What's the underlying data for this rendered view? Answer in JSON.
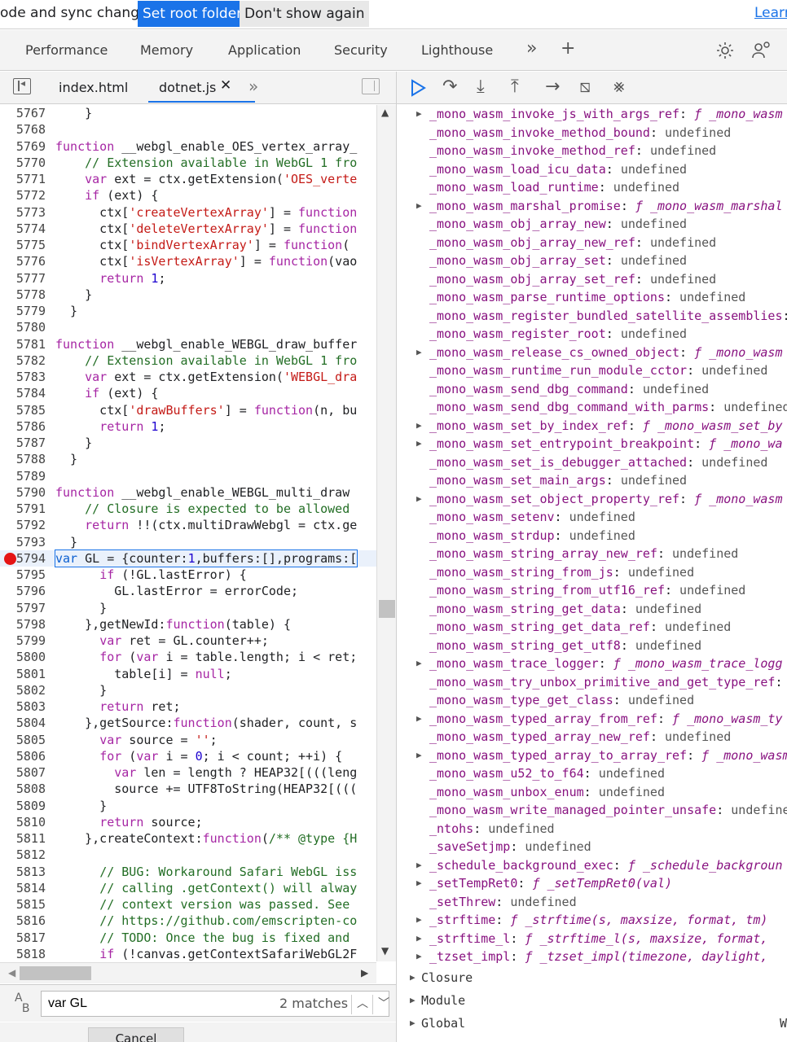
{
  "infobar": {
    "message": "ode and sync changes.",
    "set_root": "Set root folder",
    "dont_show": "Don't show again",
    "learn": "Learn"
  },
  "panel_tabs": [
    "Performance",
    "Memory",
    "Application",
    "Security",
    "Lighthouse"
  ],
  "file_tabs": [
    "index.html",
    "dotnet.js"
  ],
  "code_lines": [
    {
      "n": "5767",
      "html": "    }"
    },
    {
      "n": "5768",
      "html": ""
    },
    {
      "n": "5769",
      "html": "<span class=\"kw\">function</span> __webgl_enable_OES_vertex_array_"
    },
    {
      "n": "5770",
      "html": "    <span class=\"cm\">// Extension available in WebGL 1 fro</span>"
    },
    {
      "n": "5771",
      "html": "    <span class=\"kw\">var</span> ext = ctx.getExtension(<span class=\"str\">'OES_verte</span>"
    },
    {
      "n": "5772",
      "html": "    <span class=\"kw\">if</span> (ext) {"
    },
    {
      "n": "5773",
      "html": "      ctx[<span class=\"str\">'createVertexArray'</span>] = <span class=\"kw\">function</span>"
    },
    {
      "n": "5774",
      "html": "      ctx[<span class=\"str\">'deleteVertexArray'</span>] = <span class=\"kw\">function</span>"
    },
    {
      "n": "5775",
      "html": "      ctx[<span class=\"str\">'bindVertexArray'</span>] = <span class=\"kw\">function</span>("
    },
    {
      "n": "5776",
      "html": "      ctx[<span class=\"str\">'isVertexArray'</span>] = <span class=\"kw\">function</span>(vao"
    },
    {
      "n": "5777",
      "html": "      <span class=\"kw\">return</span> <span class=\"num\">1</span>;"
    },
    {
      "n": "5778",
      "html": "    }"
    },
    {
      "n": "5779",
      "html": "  }"
    },
    {
      "n": "5780",
      "html": ""
    },
    {
      "n": "5781",
      "html": "<span class=\"kw\">function</span> __webgl_enable_WEBGL_draw_buffer"
    },
    {
      "n": "5782",
      "html": "    <span class=\"cm\">// Extension available in WebGL 1 fro</span>"
    },
    {
      "n": "5783",
      "html": "    <span class=\"kw\">var</span> ext = ctx.getExtension(<span class=\"str\">'WEBGL_dra</span>"
    },
    {
      "n": "5784",
      "html": "    <span class=\"kw\">if</span> (ext) {"
    },
    {
      "n": "5785",
      "html": "      ctx[<span class=\"str\">'drawBuffers'</span>] = <span class=\"kw\">function</span>(n, bu"
    },
    {
      "n": "5786",
      "html": "      <span class=\"kw\">return</span> <span class=\"num\">1</span>;"
    },
    {
      "n": "5787",
      "html": "    }"
    },
    {
      "n": "5788",
      "html": "  }"
    },
    {
      "n": "5789",
      "html": ""
    },
    {
      "n": "5790",
      "html": "<span class=\"kw\">function</span> __webgl_enable_WEBGL_multi_draw"
    },
    {
      "n": "5791",
      "html": "    <span class=\"cm\">// Closure is expected to be allowed</span>"
    },
    {
      "n": "5792",
      "html": "    <span class=\"kw\">return</span> !!(ctx.multiDrawWebgl = ctx.ge"
    },
    {
      "n": "5793",
      "html": "  }"
    },
    {
      "n": "5794",
      "html": "<span class=\"kw2\">var</span> GL = {counter:<span class=\"num\">1</span>,buffers:[],programs:[",
      "bp": true
    },
    {
      "n": "5795",
      "html": "      <span class=\"kw\">if</span> (!GL.lastError) {"
    },
    {
      "n": "5796",
      "html": "        GL.lastError = errorCode;"
    },
    {
      "n": "5797",
      "html": "      }"
    },
    {
      "n": "5798",
      "html": "    },getNewId:<span class=\"kw\">function</span>(table) {"
    },
    {
      "n": "5799",
      "html": "      <span class=\"kw\">var</span> ret = GL.counter++;"
    },
    {
      "n": "5800",
      "html": "      <span class=\"kw\">for</span> (<span class=\"kw\">var</span> i = table.length; i &lt; ret;"
    },
    {
      "n": "5801",
      "html": "        table[i] = <span class=\"kw\">null</span>;"
    },
    {
      "n": "5802",
      "html": "      }"
    },
    {
      "n": "5803",
      "html": "      <span class=\"kw\">return</span> ret;"
    },
    {
      "n": "5804",
      "html": "    },getSource:<span class=\"kw\">function</span>(shader, count, s"
    },
    {
      "n": "5805",
      "html": "      <span class=\"kw\">var</span> source = <span class=\"str\">''</span>;"
    },
    {
      "n": "5806",
      "html": "      <span class=\"kw\">for</span> (<span class=\"kw\">var</span> i = <span class=\"num\">0</span>; i &lt; count; ++i) {"
    },
    {
      "n": "5807",
      "html": "        <span class=\"kw\">var</span> len = length ? HEAP32[(((leng"
    },
    {
      "n": "5808",
      "html": "        source += UTF8ToString(HEAP32[((("
    },
    {
      "n": "5809",
      "html": "      }"
    },
    {
      "n": "5810",
      "html": "      <span class=\"kw\">return</span> source;"
    },
    {
      "n": "5811",
      "html": "    },createContext:<span class=\"kw\">function</span>(<span class=\"cm\">/** @type {H</span>"
    },
    {
      "n": "5812",
      "html": ""
    },
    {
      "n": "5813",
      "html": "      <span class=\"cm\">// BUG: Workaround Safari WebGL iss</span>"
    },
    {
      "n": "5814",
      "html": "      <span class=\"cm\">// calling .getContext() will alway</span>"
    },
    {
      "n": "5815",
      "html": "      <span class=\"cm\">// context version was passed. See</span>"
    },
    {
      "n": "5816",
      "html": "      <span class=\"cm\">// https://github.com/emscripten-co</span>"
    },
    {
      "n": "5817",
      "html": "      <span class=\"cm\">// TODO: Once the bug is fixed and</span>"
    },
    {
      "n": "5818",
      "html": "      <span class=\"kw\">if</span> (!canvas.getContextSafariWebGL2F"
    }
  ],
  "scope_rows": [
    {
      "a": true,
      "k": "_mono_wasm_invoke_js_with_args_ref",
      "f": "_mono_wasm"
    },
    {
      "a": false,
      "k": "_mono_wasm_invoke_method_bound",
      "v": "undefined"
    },
    {
      "a": false,
      "k": "_mono_wasm_invoke_method_ref",
      "v": "undefined"
    },
    {
      "a": false,
      "k": "_mono_wasm_load_icu_data",
      "v": "undefined"
    },
    {
      "a": false,
      "k": "_mono_wasm_load_runtime",
      "v": "undefined"
    },
    {
      "a": true,
      "k": "_mono_wasm_marshal_promise",
      "f": "_mono_wasm_marshal"
    },
    {
      "a": false,
      "k": "_mono_wasm_obj_array_new",
      "v": "undefined"
    },
    {
      "a": false,
      "k": "_mono_wasm_obj_array_new_ref",
      "v": "undefined"
    },
    {
      "a": false,
      "k": "_mono_wasm_obj_array_set",
      "v": "undefined"
    },
    {
      "a": false,
      "k": "_mono_wasm_obj_array_set_ref",
      "v": "undefined"
    },
    {
      "a": false,
      "k": "_mono_wasm_parse_runtime_options",
      "v": "undefined"
    },
    {
      "a": false,
      "k": "_mono_wasm_register_bundled_satellite_assemblies",
      "v": ""
    },
    {
      "a": false,
      "k": "_mono_wasm_register_root",
      "v": "undefined"
    },
    {
      "a": true,
      "k": "_mono_wasm_release_cs_owned_object",
      "f": "_mono_wasm"
    },
    {
      "a": false,
      "k": "_mono_wasm_runtime_run_module_cctor",
      "v": "undefined"
    },
    {
      "a": false,
      "k": "_mono_wasm_send_dbg_command",
      "v": "undefined"
    },
    {
      "a": false,
      "k": "_mono_wasm_send_dbg_command_with_parms",
      "v": "undefined"
    },
    {
      "a": true,
      "k": "_mono_wasm_set_by_index_ref",
      "f": "_mono_wasm_set_by"
    },
    {
      "a": true,
      "k": "_mono_wasm_set_entrypoint_breakpoint",
      "f": "_mono_wa"
    },
    {
      "a": false,
      "k": "_mono_wasm_set_is_debugger_attached",
      "v": "undefined"
    },
    {
      "a": false,
      "k": "_mono_wasm_set_main_args",
      "v": "undefined"
    },
    {
      "a": true,
      "k": "_mono_wasm_set_object_property_ref",
      "f": "_mono_wasm"
    },
    {
      "a": false,
      "k": "_mono_wasm_setenv",
      "v": "undefined"
    },
    {
      "a": false,
      "k": "_mono_wasm_strdup",
      "v": "undefined"
    },
    {
      "a": false,
      "k": "_mono_wasm_string_array_new_ref",
      "v": "undefined"
    },
    {
      "a": false,
      "k": "_mono_wasm_string_from_js",
      "v": "undefined"
    },
    {
      "a": false,
      "k": "_mono_wasm_string_from_utf16_ref",
      "v": "undefined"
    },
    {
      "a": false,
      "k": "_mono_wasm_string_get_data",
      "v": "undefined"
    },
    {
      "a": false,
      "k": "_mono_wasm_string_get_data_ref",
      "v": "undefined"
    },
    {
      "a": false,
      "k": "_mono_wasm_string_get_utf8",
      "v": "undefined"
    },
    {
      "a": true,
      "k": "_mono_wasm_trace_logger",
      "f": "_mono_wasm_trace_logg"
    },
    {
      "a": false,
      "k": "_mono_wasm_try_unbox_primitive_and_get_type_ref",
      "v": ""
    },
    {
      "a": false,
      "k": "_mono_wasm_type_get_class",
      "v": "undefined"
    },
    {
      "a": true,
      "k": "_mono_wasm_typed_array_from_ref",
      "f": "_mono_wasm_ty"
    },
    {
      "a": false,
      "k": "_mono_wasm_typed_array_new_ref",
      "v": "undefined"
    },
    {
      "a": true,
      "k": "_mono_wasm_typed_array_to_array_ref",
      "f": "_mono_wasm"
    },
    {
      "a": false,
      "k": "_mono_wasm_u52_to_f64",
      "v": "undefined"
    },
    {
      "a": false,
      "k": "_mono_wasm_unbox_enum",
      "v": "undefined"
    },
    {
      "a": false,
      "k": "_mono_wasm_write_managed_pointer_unsafe",
      "v": "undefined"
    },
    {
      "a": false,
      "k": "_ntohs",
      "v": "undefined"
    },
    {
      "a": false,
      "k": "_saveSetjmp",
      "v": "undefined"
    },
    {
      "a": true,
      "k": "_schedule_background_exec",
      "f": "_schedule_backgroun"
    },
    {
      "a": true,
      "k": "_setTempRet0",
      "f": "_setTempRet0(val)"
    },
    {
      "a": false,
      "k": "_setThrew",
      "v": "undefined"
    },
    {
      "a": true,
      "k": "_strftime",
      "f": "_strftime(s, maxsize, format, tm)"
    },
    {
      "a": true,
      "k": "_strftime_l",
      "f": "_strftime_l(s, maxsize, format,"
    },
    {
      "a": true,
      "k": "_tzset_impl",
      "f": "_tzset_impl(timezone, daylight,"
    }
  ],
  "scope_sections": [
    "Closure",
    "Module",
    "Global"
  ],
  "scope_global_extra": "W",
  "search": {
    "value": "var GL",
    "matches": "2 matches",
    "cancel": "Cancel"
  },
  "colors": {
    "accent": "#1a73e8",
    "breakpoint": "#e51414"
  }
}
